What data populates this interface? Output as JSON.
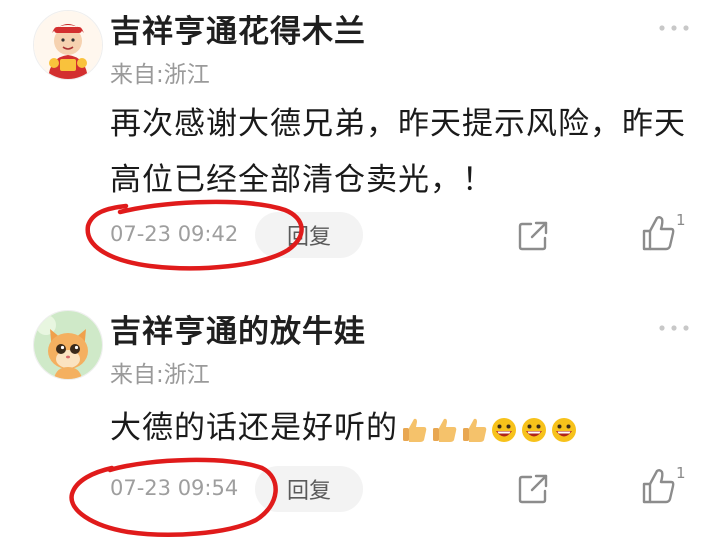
{
  "comments": [
    {
      "username": "吉祥亨通花得木兰",
      "location": "来自:浙江",
      "text": "再次感谢大德兄弟，昨天提示风险，昨天高位已经全部清仓卖光，！",
      "time": "07-23 09:42",
      "reply_label": "回复",
      "like_count": "1"
    },
    {
      "username": "吉祥亨通的放牛娃",
      "location": "来自:浙江",
      "text": "大德的话还是好听的",
      "emojis": [
        "thumbs-up",
        "thumbs-up",
        "thumbs-up",
        "grinning-face",
        "grinning-face",
        "grinning-face"
      ],
      "time": "07-23 09:54",
      "reply_label": "回复",
      "like_count": "1"
    }
  ],
  "colors": {
    "annotation_red": "#e01b1b",
    "meta_gray": "#9e9e9e",
    "reply_bg": "#f3f3f3"
  }
}
